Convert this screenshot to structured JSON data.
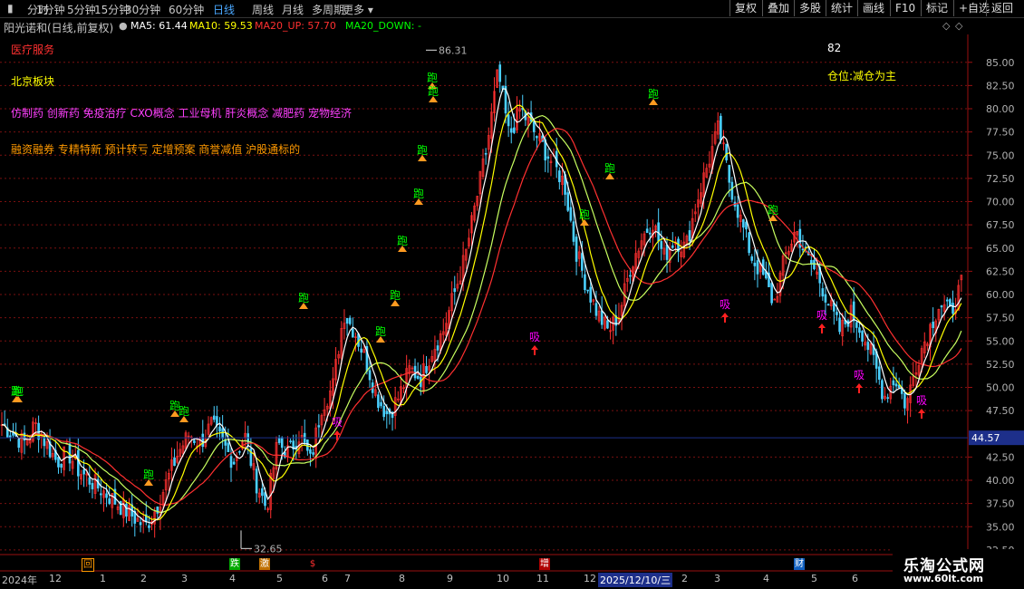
{
  "toolbar": {
    "periods": [
      "分时",
      "1分钟",
      "5分钟",
      "15分钟",
      "30分钟",
      "60分钟",
      "日线",
      "周线",
      "月线",
      "多周期",
      "更多"
    ],
    "active_period": "日线",
    "buttons": [
      "复权",
      "叠加",
      "多股",
      "统计",
      "画线",
      "F10",
      "标记",
      "+自选",
      "返回"
    ]
  },
  "stock": {
    "title": "阳光诺和(日线,前复权)"
  },
  "ma": {
    "ma5": "MA5: 61.44",
    "ma10": "MA10: 59.53",
    "ma20_up": "MA20_UP: 57.70",
    "ma20_down": "MA20_DOWN: -"
  },
  "info": {
    "industry": "医疗服务",
    "board": "北京板块",
    "concepts": "仿制药 创新药 免疫治疗 CXO概念 工业母机 肝炎概念 减肥药 宠物经济",
    "tags": "融资融券 专精特新 预计转亏 定增预案 商誉减值 沪股通标的",
    "score": "82",
    "position_advice": "仓位:减仓为主"
  },
  "chart_data": {
    "type": "candlestick",
    "ylim": [
      32.0,
      88.0
    ],
    "y_ticks": [
      "85.00",
      "82.50",
      "80.00",
      "77.50",
      "75.00",
      "72.50",
      "70.00",
      "67.50",
      "65.00",
      "62.50",
      "60.00",
      "57.50",
      "55.00",
      "52.50",
      "50.00",
      "47.50",
      "42.50",
      "40.00",
      "37.50",
      "35.00",
      "32.50"
    ],
    "current_price": "44.57",
    "max_label": "86.31",
    "min_label": "32.65",
    "x_labels": [
      "2024年",
      "12",
      "1",
      "2",
      "3",
      "4",
      "5",
      "6",
      "7",
      "8",
      "9",
      "10",
      "11",
      "12",
      "2025/12/10/三",
      "2",
      "3",
      "4",
      "5",
      "6"
    ],
    "signal_labels": {
      "run": "跑",
      "buy": "吸"
    },
    "event_marks": [
      "回",
      "跌",
      "激",
      "$",
      "增",
      "财"
    ],
    "close_path": [
      46,
      45,
      44,
      46,
      44,
      42,
      43,
      41,
      40,
      39,
      38,
      37,
      36,
      35,
      37,
      40,
      43,
      45,
      44,
      46,
      44,
      42,
      45,
      40,
      37,
      44,
      43,
      45,
      42,
      48,
      50,
      58,
      56,
      53,
      49,
      47,
      49,
      52,
      51,
      54,
      56,
      60,
      64,
      70,
      76,
      84,
      77,
      80,
      78,
      76,
      74,
      72,
      65,
      61,
      58,
      56,
      58,
      63,
      66,
      68,
      64,
      66,
      65,
      70,
      74,
      78,
      72,
      68,
      64,
      62,
      59,
      64,
      67,
      64,
      62,
      59,
      56,
      58,
      56,
      53,
      49,
      51,
      48,
      53,
      56,
      59,
      58,
      61
    ]
  },
  "colors": {
    "ma5": "#ffffff",
    "ma10": "#ffff00",
    "ma20_up": "#ff3030",
    "ma20_down": "#00ff00",
    "up": "#ff3030",
    "down": "#4ad0ff",
    "grid": "#7a1010",
    "signal_run": "#00ff00",
    "signal_buy": "#ff00ff"
  },
  "watermark": {
    "line1": "乐淘公式网",
    "line2": "www.60lt.com"
  }
}
